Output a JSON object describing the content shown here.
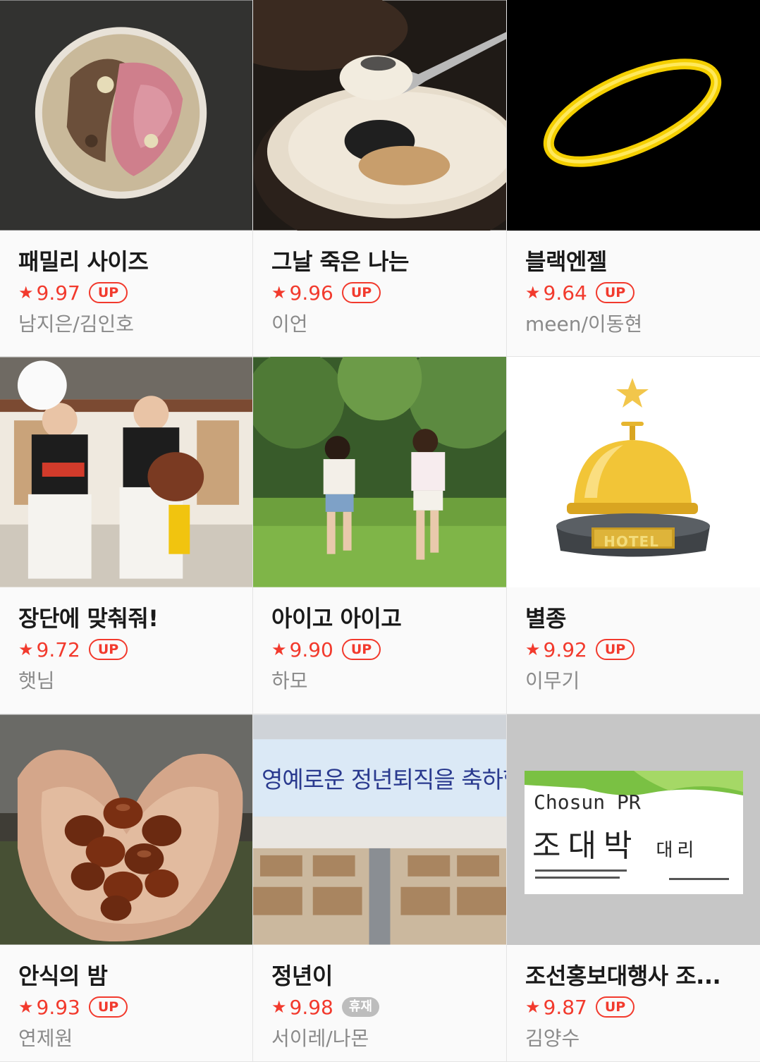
{
  "items": [
    {
      "title": "패밀리 사이즈",
      "rating": "9.97",
      "badge": "UP",
      "author": "남지은/김인호"
    },
    {
      "title": "그날 죽은 나는",
      "rating": "9.96",
      "badge": "UP",
      "author": "이언"
    },
    {
      "title": "블랙엔젤",
      "rating": "9.64",
      "badge": "UP",
      "author": "meen/이동현"
    },
    {
      "title": "장단에 맞춰줘!",
      "rating": "9.72",
      "badge": "UP",
      "author": "햇님"
    },
    {
      "title": "아이고 아이고",
      "rating": "9.90",
      "badge": "UP",
      "author": "하모"
    },
    {
      "title": "별종",
      "rating": "9.92",
      "badge": "UP",
      "author": "이무기",
      "thumb_text": "HOTEL"
    },
    {
      "title": "안식의 밤",
      "rating": "9.93",
      "badge": "UP",
      "author": "연제원"
    },
    {
      "title": "정년이",
      "rating": "9.98",
      "badge": "휴재",
      "author": "서이레/나몬",
      "thumb_text": "영예로운 정년퇴직을 축하합니다"
    },
    {
      "title": "조선홍보대행사 조...",
      "rating": "9.87",
      "badge": "UP",
      "author": "김양수",
      "thumb_company": "Chosun PR",
      "thumb_name": "조대박",
      "thumb_position": "대리"
    }
  ],
  "star_glyph": "★",
  "colors": {
    "accent": "#f23a2d",
    "muted": "#8a8a8a",
    "rest_badge": "#bdbdbd"
  }
}
